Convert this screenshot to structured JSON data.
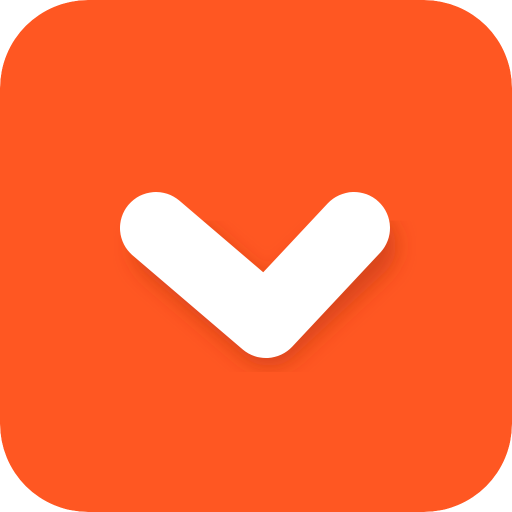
{
  "icon": {
    "name": "chevron-down-icon",
    "background_color": "#FF5722",
    "glyph_color": "#FFFFFF",
    "shadow_color": "#B8360E"
  }
}
